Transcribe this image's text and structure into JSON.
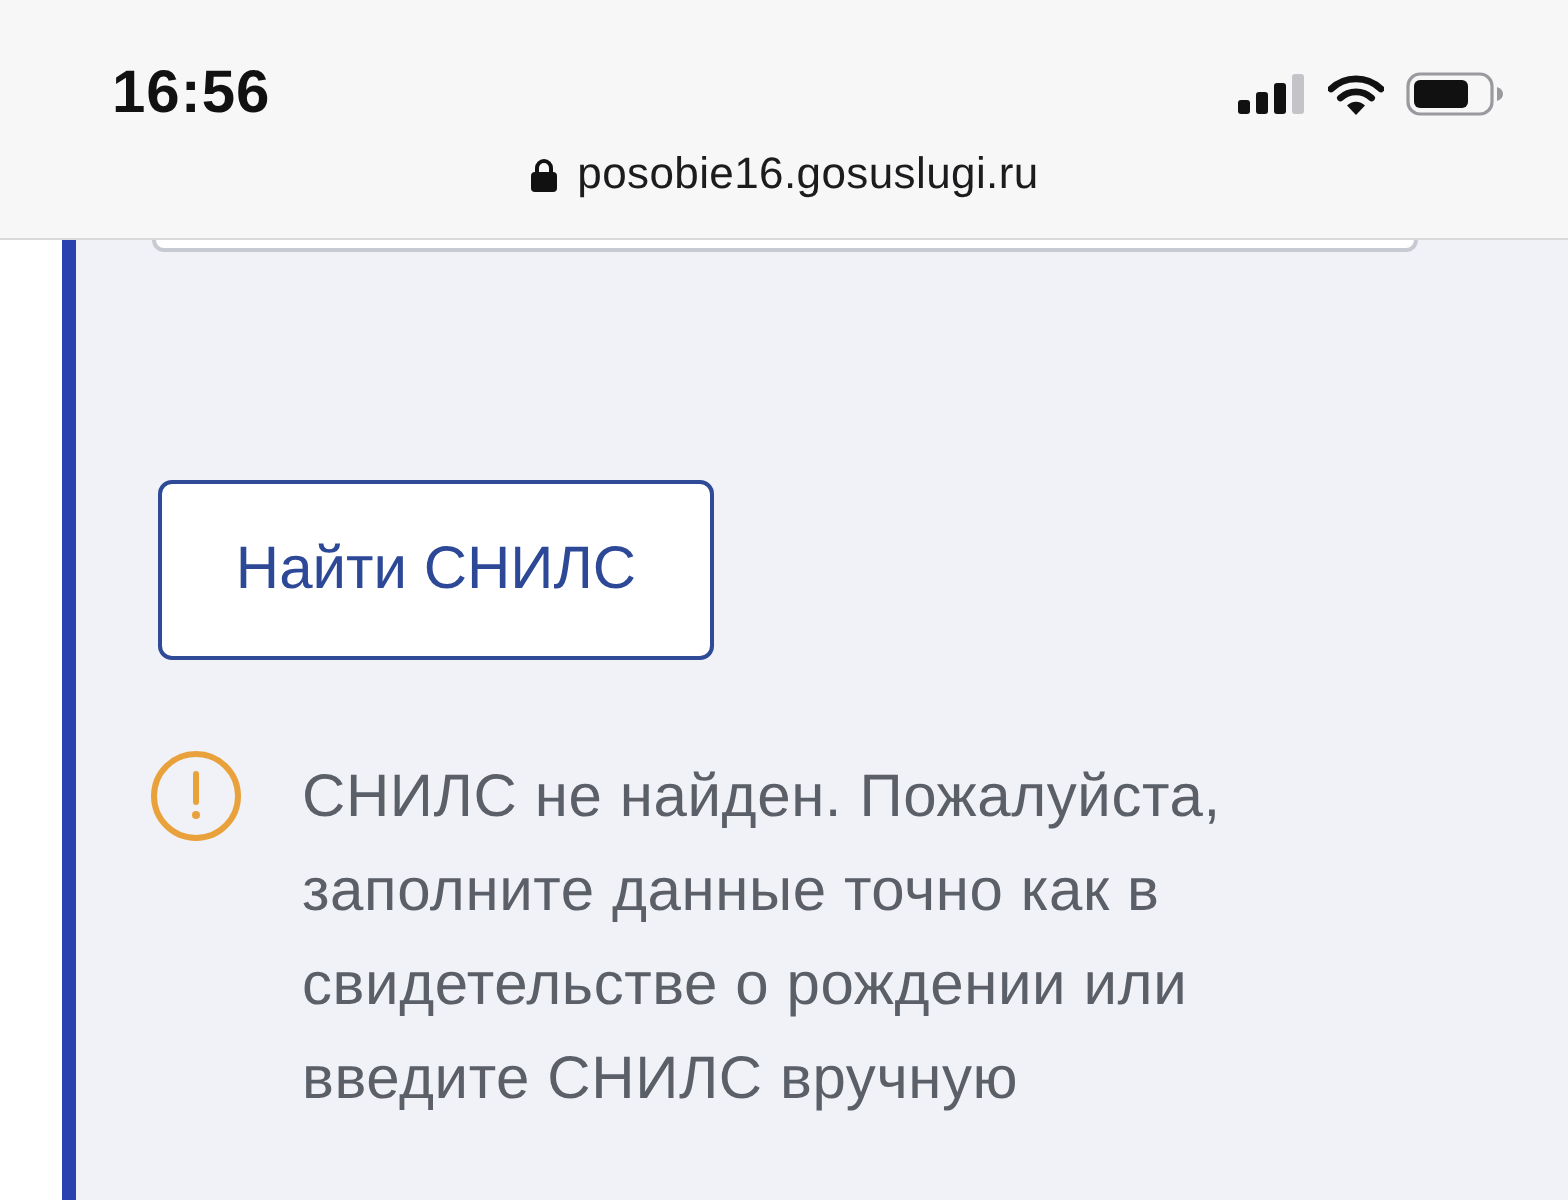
{
  "status_bar": {
    "time": "16:56"
  },
  "address_bar": {
    "url": "posobie16.gosuslugi.ru"
  },
  "form": {
    "find_button": {
      "label": "Найти СНИЛС"
    },
    "alert": {
      "kind": "warning",
      "message": "СНИЛС не найден. Пожалуйста, заполните данные точно как в свидетельстве о рождении или введите СНИЛС вручную"
    }
  }
}
